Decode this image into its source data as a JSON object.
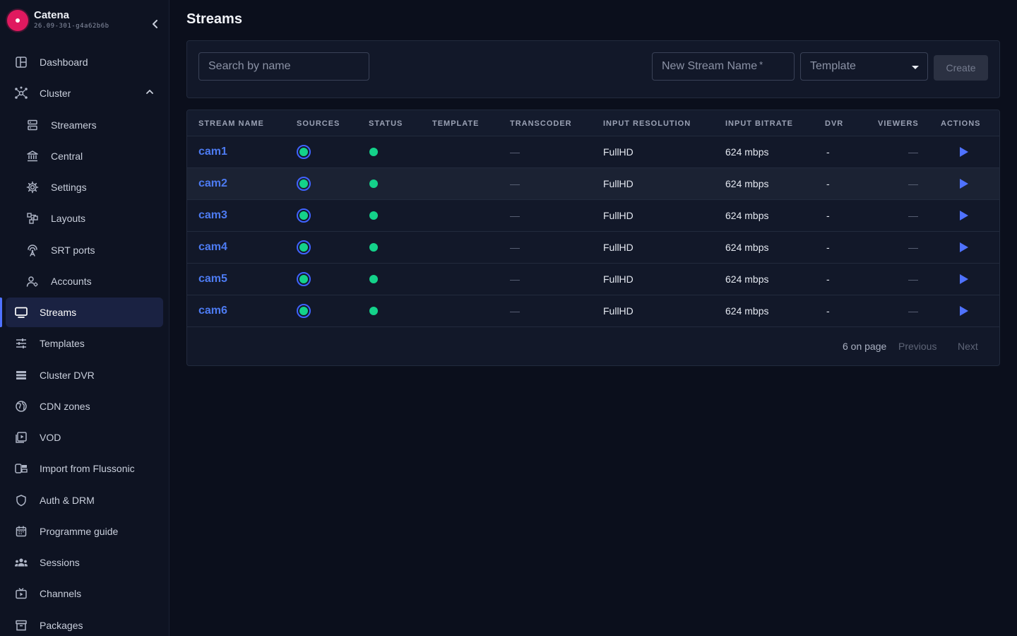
{
  "brand": {
    "name": "Catena",
    "version": "26.09-301-g4a62b6b"
  },
  "sidebar": {
    "items": [
      {
        "label": "Dashboard",
        "icon": "dashboard-icon"
      },
      {
        "label": "Cluster",
        "icon": "cluster-icon",
        "expanded": true
      },
      {
        "label": "Streamers",
        "icon": "server-icon"
      },
      {
        "label": "Central",
        "icon": "bank-icon"
      },
      {
        "label": "Settings",
        "icon": "gear-icon"
      },
      {
        "label": "Layouts",
        "icon": "layouts-icon"
      },
      {
        "label": "SRT ports",
        "icon": "antenna-icon"
      },
      {
        "label": "Accounts",
        "icon": "accounts-icon"
      },
      {
        "label": "Streams",
        "icon": "monitor-icon",
        "active": true
      },
      {
        "label": "Templates",
        "icon": "sliders-icon"
      },
      {
        "label": "Cluster DVR",
        "icon": "dvr-icon"
      },
      {
        "label": "CDN zones",
        "icon": "globe-icon"
      },
      {
        "label": "VOD",
        "icon": "vod-icon"
      },
      {
        "label": "Import from Flussonic",
        "icon": "import-icon"
      },
      {
        "label": "Auth & DRM",
        "icon": "shield-icon"
      },
      {
        "label": "Programme guide",
        "icon": "calendar-icon"
      },
      {
        "label": "Sessions",
        "icon": "users-icon"
      },
      {
        "label": "Channels",
        "icon": "tv-icon"
      },
      {
        "label": "Packages",
        "icon": "package-icon"
      }
    ]
  },
  "page": {
    "title": "Streams"
  },
  "toolbar": {
    "search_placeholder": "Search by name",
    "new_name_placeholder": "New Stream Name",
    "required_mark": "*",
    "template_placeholder": "Template",
    "create_label": "Create"
  },
  "table": {
    "columns": [
      "STREAM NAME",
      "SOURCES",
      "STATUS",
      "TEMPLATE",
      "TRANSCODER",
      "INPUT RESOLUTION",
      "INPUT BITRATE",
      "DVR",
      "VIEWERS",
      "ACTIONS"
    ],
    "rows": [
      {
        "name": "cam1",
        "template": "",
        "transcoder": "—",
        "resolution": "FullHD",
        "bitrate": "624 mbps",
        "dvr": "-",
        "viewers": "—"
      },
      {
        "name": "cam2",
        "template": "",
        "transcoder": "—",
        "resolution": "FullHD",
        "bitrate": "624 mbps",
        "dvr": "-",
        "viewers": "—"
      },
      {
        "name": "cam3",
        "template": "",
        "transcoder": "—",
        "resolution": "FullHD",
        "bitrate": "624 mbps",
        "dvr": "-",
        "viewers": "—"
      },
      {
        "name": "cam4",
        "template": "",
        "transcoder": "—",
        "resolution": "FullHD",
        "bitrate": "624 mbps",
        "dvr": "-",
        "viewers": "—"
      },
      {
        "name": "cam5",
        "template": "",
        "transcoder": "—",
        "resolution": "FullHD",
        "bitrate": "624 mbps",
        "dvr": "-",
        "viewers": "—"
      },
      {
        "name": "cam6",
        "template": "",
        "transcoder": "—",
        "resolution": "FullHD",
        "bitrate": "624 mbps",
        "dvr": "-",
        "viewers": "—"
      }
    ],
    "highlighted_row": 1
  },
  "pagination": {
    "count_label": "6 on page",
    "previous_label": "Previous",
    "next_label": "Next"
  },
  "colors": {
    "accent": "#4f72ff",
    "status_online": "#14d28a",
    "link": "#4d7bf2",
    "brand": "#e0195f"
  }
}
